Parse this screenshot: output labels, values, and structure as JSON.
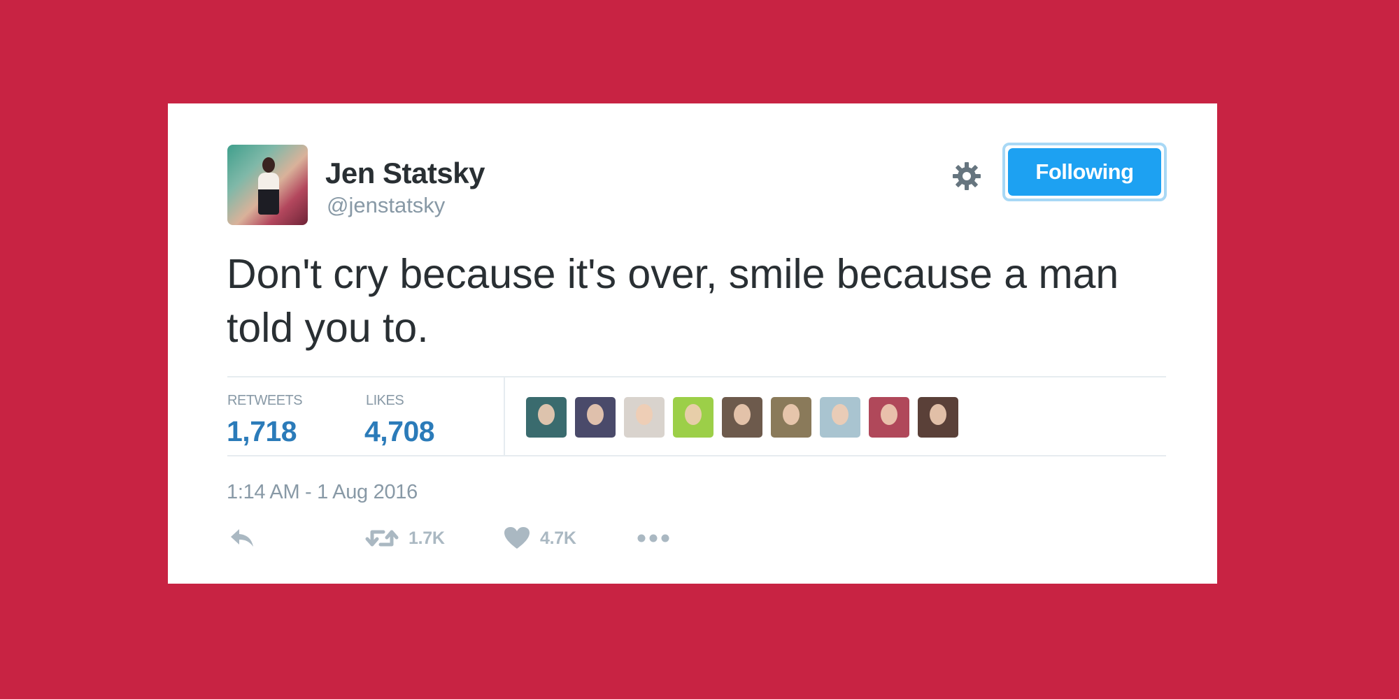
{
  "tweet": {
    "author": {
      "name": "Jen Statsky",
      "handle": "@jenstatsky",
      "avatar_icon": "profile-photo"
    },
    "follow_button_label": "Following",
    "settings_icon": "gear-icon",
    "text": "Don't cry because it's over, smile because a man told you to.",
    "stats": {
      "retweets_label": "RETWEETS",
      "retweets_value": "1,718",
      "likes_label": "LIKES",
      "likes_value": "4,708"
    },
    "liker_avatars": [
      {
        "color": "#3a6b6e"
      },
      {
        "color": "#4a4a6a"
      },
      {
        "color": "#d9d3cd"
      },
      {
        "color": "#9ccf48"
      },
      {
        "color": "#6d5a4c"
      },
      {
        "color": "#8a7a5a"
      },
      {
        "color": "#a9c4d0"
      },
      {
        "color": "#b0485a"
      },
      {
        "color": "#5a4038"
      }
    ],
    "timestamp": "1:14 AM - 1 Aug 2016",
    "actions": {
      "reply_icon": "reply-icon",
      "retweet_icon": "retweet-icon",
      "retweet_count": "1.7K",
      "like_icon": "heart-icon",
      "like_count": "4.7K",
      "more_icon": "more-icon"
    }
  },
  "colors": {
    "background": "#c82343",
    "card": "#ffffff",
    "accent": "#1da1f2",
    "stat_value": "#2b7bb9",
    "text": "#292f33",
    "muted": "#8899a6"
  }
}
